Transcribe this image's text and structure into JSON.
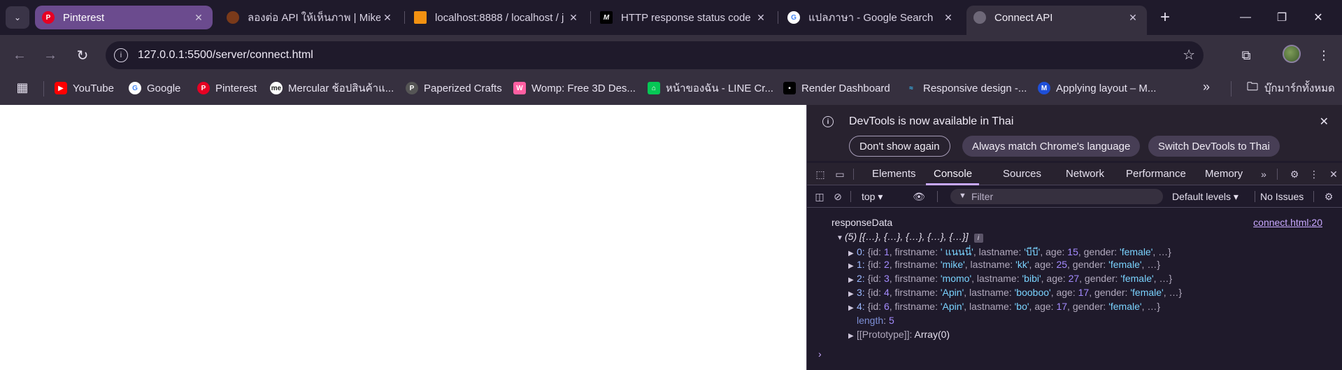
{
  "tabs": [
    {
      "title": "Pinterest",
      "icon": "pinterest-icon"
    },
    {
      "title": "ลองต่อ API ให้เห็นภาพ | MikeW",
      "icon": "avatar-icon"
    },
    {
      "title": "localhost:8888 / localhost / j",
      "icon": "phpmyadmin-icon"
    },
    {
      "title": "HTTP response status code",
      "icon": "mdn-icon"
    },
    {
      "title": "แปลภาษา - Google Search",
      "icon": "google-icon"
    },
    {
      "title": "Connect API",
      "icon": "globe-icon"
    }
  ],
  "address_bar": {
    "url": "127.0.0.1:5500/server/connect.html"
  },
  "bookmarks": [
    {
      "label": "YouTube",
      "icon": "youtube-icon"
    },
    {
      "label": "Google",
      "icon": "google-icon"
    },
    {
      "label": "Pinterest",
      "icon": "pinterest-icon"
    },
    {
      "label": "Mercular ช้อปสินค้าแ...",
      "icon": "mercular-icon"
    },
    {
      "label": "Paperized Crafts",
      "icon": "paperized-icon"
    },
    {
      "label": "Womp: Free 3D Des...",
      "icon": "womp-icon"
    },
    {
      "label": "หน้าของฉัน - LINE Cr...",
      "icon": "line-icon"
    },
    {
      "label": "Render Dashboard",
      "icon": "render-icon"
    },
    {
      "label": "Responsive design -...",
      "icon": "tailwind-icon"
    },
    {
      "label": "Applying layout – M...",
      "icon": "mui-icon"
    }
  ],
  "bookmarks_folder": "บุ๊กมาร์กทั้งหมด",
  "devtools": {
    "banner": {
      "title": "DevTools is now available in Thai",
      "dont_show": "Don't show again",
      "always_match": "Always match Chrome's language",
      "switch": "Switch DevTools to Thai"
    },
    "tabs": [
      "Elements",
      "Console",
      "Sources",
      "Network",
      "Performance",
      "Memory"
    ],
    "active_tab": "Console",
    "context": "top",
    "filter_placeholder": "Filter",
    "levels": "Default levels",
    "issues": "No Issues",
    "console": {
      "label": "responseData",
      "source": "connect.html:20",
      "summary": "(5) [{…}, {…}, {…}, {…}, {…}]",
      "rows": [
        {
          "index": "0",
          "id": "1",
          "firstname": "' แนนนี่'",
          "lastname": "'บีบี'",
          "age": "15",
          "gender": "'female'"
        },
        {
          "index": "1",
          "id": "2",
          "firstname": "'mike'",
          "lastname": "'kk'",
          "age": "25",
          "gender": "'female'"
        },
        {
          "index": "2",
          "id": "3",
          "firstname": "'momo'",
          "lastname": "'bibi'",
          "age": "27",
          "gender": "'female'"
        },
        {
          "index": "3",
          "id": "4",
          "firstname": "'Apin'",
          "lastname": "'booboo'",
          "age": "17",
          "gender": "'female'"
        },
        {
          "index": "4",
          "id": "6",
          "firstname": "'Apin'",
          "lastname": "'bo'",
          "age": "17",
          "gender": "'female'"
        }
      ],
      "length_label": "length",
      "length_value": "5",
      "prototype_label": "[[Prototype]]",
      "prototype_value": "Array(0)"
    }
  }
}
